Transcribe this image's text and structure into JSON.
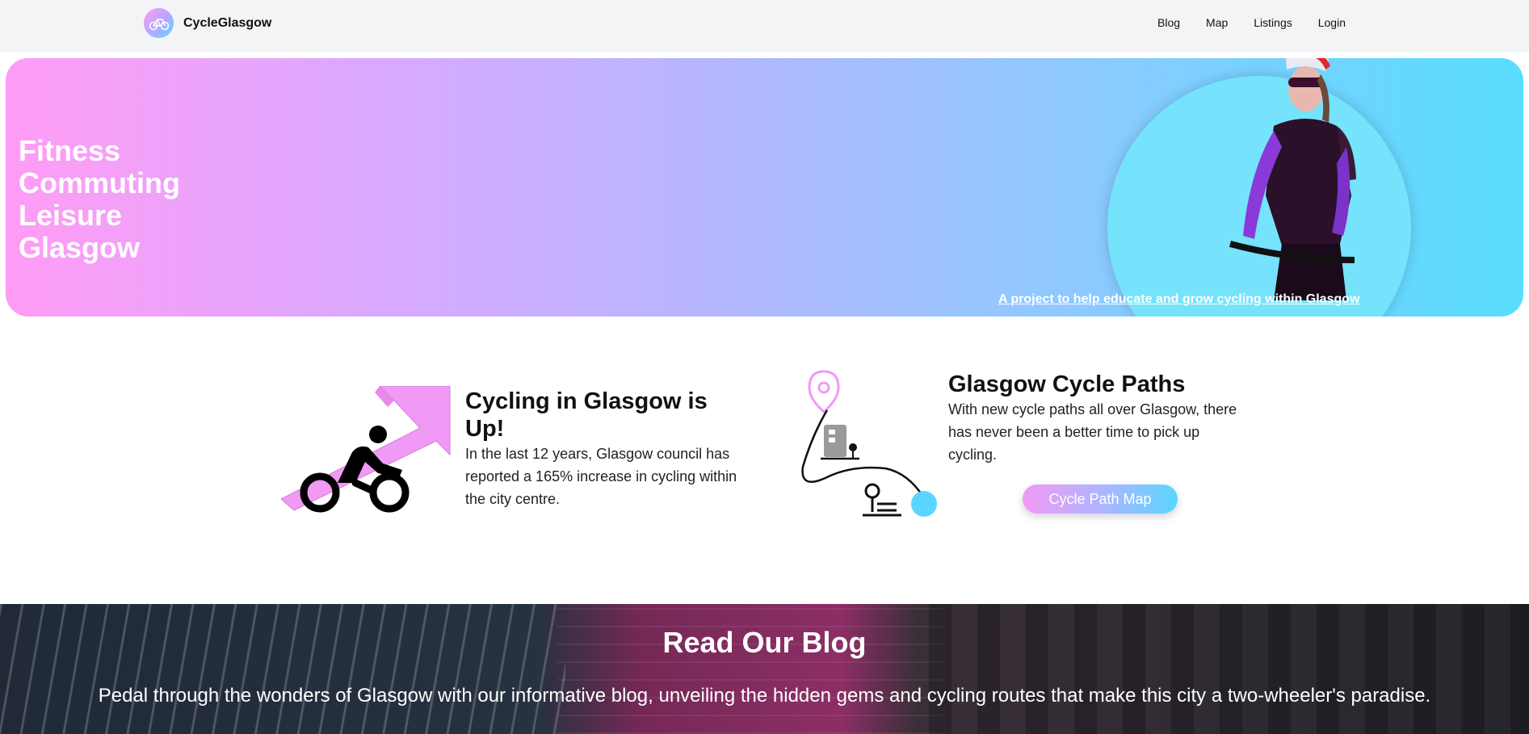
{
  "navbar": {
    "brand": "CycleGlasgow",
    "links": [
      "Blog",
      "Map",
      "Listings",
      "Login"
    ]
  },
  "hero": {
    "words": [
      "Fitness",
      "Commuting",
      "Leisure",
      "Glasgow"
    ],
    "tagline": "A project to help educate and grow cycling within Glasgow"
  },
  "features": [
    {
      "title": "Cycling in Glasgow is Up!",
      "text": "In the last 12 years, Glasgow council has reported a 165% increase in cycling within the city centre.",
      "icon": "cyclist-growth-arrow-icon"
    },
    {
      "title": "Glasgow Cycle Paths",
      "text": "With new cycle paths all over Glasgow, there has never been a better time to pick up cycling.",
      "icon": "route-map-icon",
      "button": "Cycle Path Map"
    }
  ],
  "blog": {
    "title": "Read Our Blog",
    "text": "Pedal through the wonders of Glasgow with our informative blog, unveiling the hidden gems and cycling routes that make this city a two-wheeler's paradise."
  },
  "colors": {
    "pink": "#ff9cf5",
    "cyan": "#58ddff",
    "navbar_bg": "#f3f4f6"
  }
}
